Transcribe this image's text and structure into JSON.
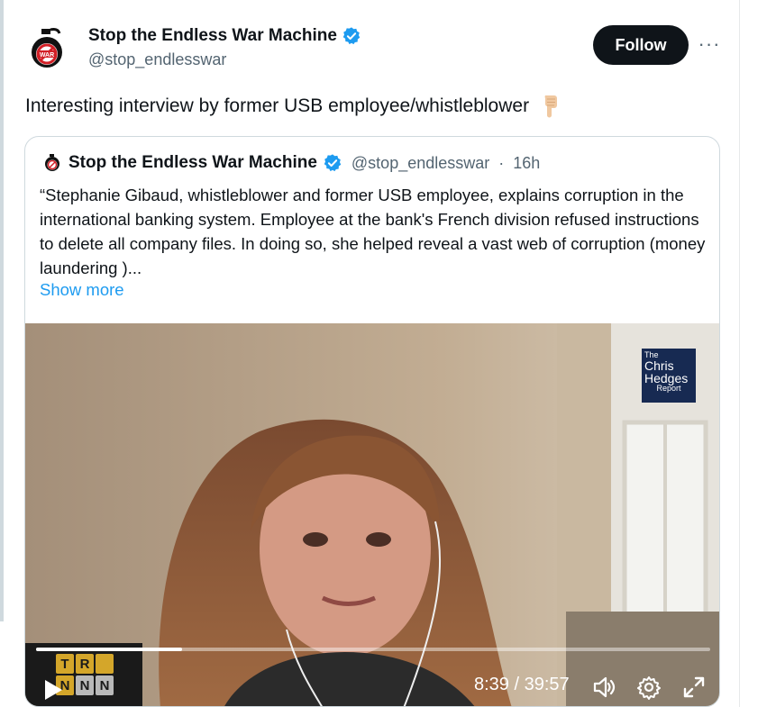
{
  "post": {
    "author_name": "Stop the Endless War Machine",
    "author_handle": "@stop_endlesswar",
    "follow_label": "Follow",
    "more_label": "···",
    "text": "Interesting interview by former USB employee/whistleblower",
    "emoji": "👇🏼"
  },
  "quote": {
    "author_name": "Stop the Endless War Machine",
    "author_handle": "@stop_endlesswar",
    "separator": "·",
    "time_ago": "16h",
    "body": "“Stephanie Gibaud, whistleblower and former USB employee, explains corruption in the international banking system. Employee at the bank's French division refused instructions to delete all company files. In doing so, she helped reveal a vast web of corruption (money laundering )...",
    "show_more": "Show more"
  },
  "video": {
    "badge_lines": [
      "The",
      "Chris",
      "Hedges",
      "Report"
    ],
    "logo_cells": [
      "T",
      "R",
      "N",
      "N",
      "N"
    ],
    "current_time": "8:39",
    "duration": "39:57",
    "time_display": "8:39 / 39:57",
    "progress_fraction": 0.2164,
    "icons": [
      "play-icon",
      "volume-icon",
      "settings-gear-icon",
      "fullscreen-icon"
    ]
  },
  "colors": {
    "accent": "#1d9bf0",
    "verified": "#1d9bf0",
    "text": "#0f1419",
    "secondary": "#536471"
  }
}
